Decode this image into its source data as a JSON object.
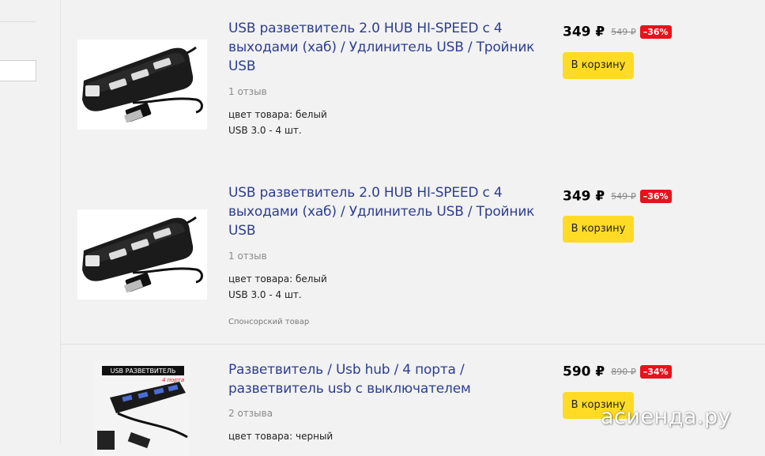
{
  "colors": {
    "background": "#f2f2f2",
    "title": "#2d3e91",
    "cart_button": "#ffdb26",
    "discount_badge": "#e8121a"
  },
  "products": [
    {
      "title": "USB разветвитель 2.0 HUB HI-SPEED с 4 выходами (хаб) / Удлинитель USB / Тройник USB",
      "reviews": "1 отзыв",
      "attr1": "цвет товара: белый",
      "attr2": "USB 3.0 - 4 шт.",
      "price": "349 ₽",
      "old_price": "549 ₽",
      "discount": "–36%",
      "cart_label": "В корзину",
      "image_icon": "usb-hub-black-photo"
    },
    {
      "title": "USB разветвитель 2.0 HUB HI-SPEED с 4 выходами (хаб) / Удлинитель USB / Тройник USB",
      "reviews": "1 отзыв",
      "attr1": "цвет товара: белый",
      "attr2": "USB 3.0 - 4 шт.",
      "sponsored": "Спонсорский товар",
      "price": "349 ₽",
      "old_price": "549 ₽",
      "discount": "–36%",
      "cart_label": "В корзину",
      "image_icon": "usb-hub-black-photo"
    },
    {
      "title": "Разветвитель / Usb hub / 4 порта / разветвитель usb с выключателем",
      "reviews": "2 отзыва",
      "attr1": "цвет товара: черный",
      "price": "590 ₽",
      "old_price": "890 ₽",
      "discount": "–34%",
      "cart_label": "В корзину",
      "box_label": "USB РАЗВЕТВИТЕЛЬ",
      "box_sublabel": "4 порта",
      "image_icon": "usb-hub-switch-box-photo"
    }
  ],
  "watermark": "асиенда.ру"
}
